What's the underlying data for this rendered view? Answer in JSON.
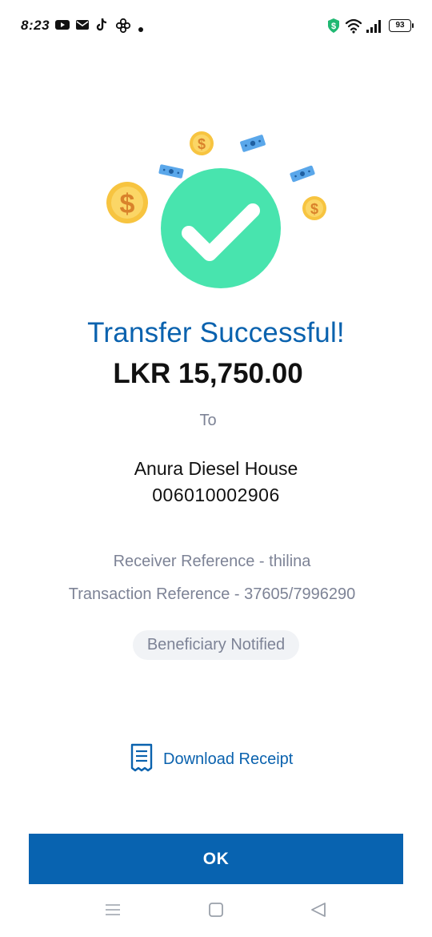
{
  "status_bar": {
    "time": "8:23",
    "icons": [
      "youtube-icon",
      "mail-icon",
      "tiktok-icon",
      "pinwheel-icon",
      "dot-icon"
    ],
    "right_icons": [
      "money-app-icon",
      "wifi-icon",
      "signal-icon"
    ],
    "battery": "93"
  },
  "hero": {
    "icons": [
      "success-check-icon",
      "coin-icon",
      "banknote-icon"
    ],
    "colors": {
      "check_circle": "#48e4ae",
      "coin": "#f7c440",
      "banknote": "#5aa7ea"
    }
  },
  "transfer": {
    "title": "Transfer Successful!",
    "amount": "LKR 15,750.00",
    "to_label": "To",
    "recipient_name": "Anura Diesel House",
    "recipient_account": "006010002906",
    "receiver_reference": "Receiver Reference - thilina",
    "transaction_reference": "Transaction Reference - 37605/7996290",
    "badge": "Beneficiary Notified"
  },
  "actions": {
    "download_label": "Download Receipt",
    "ok_label": "OK"
  },
  "nav": {
    "icons": [
      "menu-icon",
      "home-icon",
      "back-icon"
    ]
  },
  "theme": {
    "primary": "#0863b0",
    "title_color": "#0a62ae",
    "muted_text": "#7d8396"
  }
}
